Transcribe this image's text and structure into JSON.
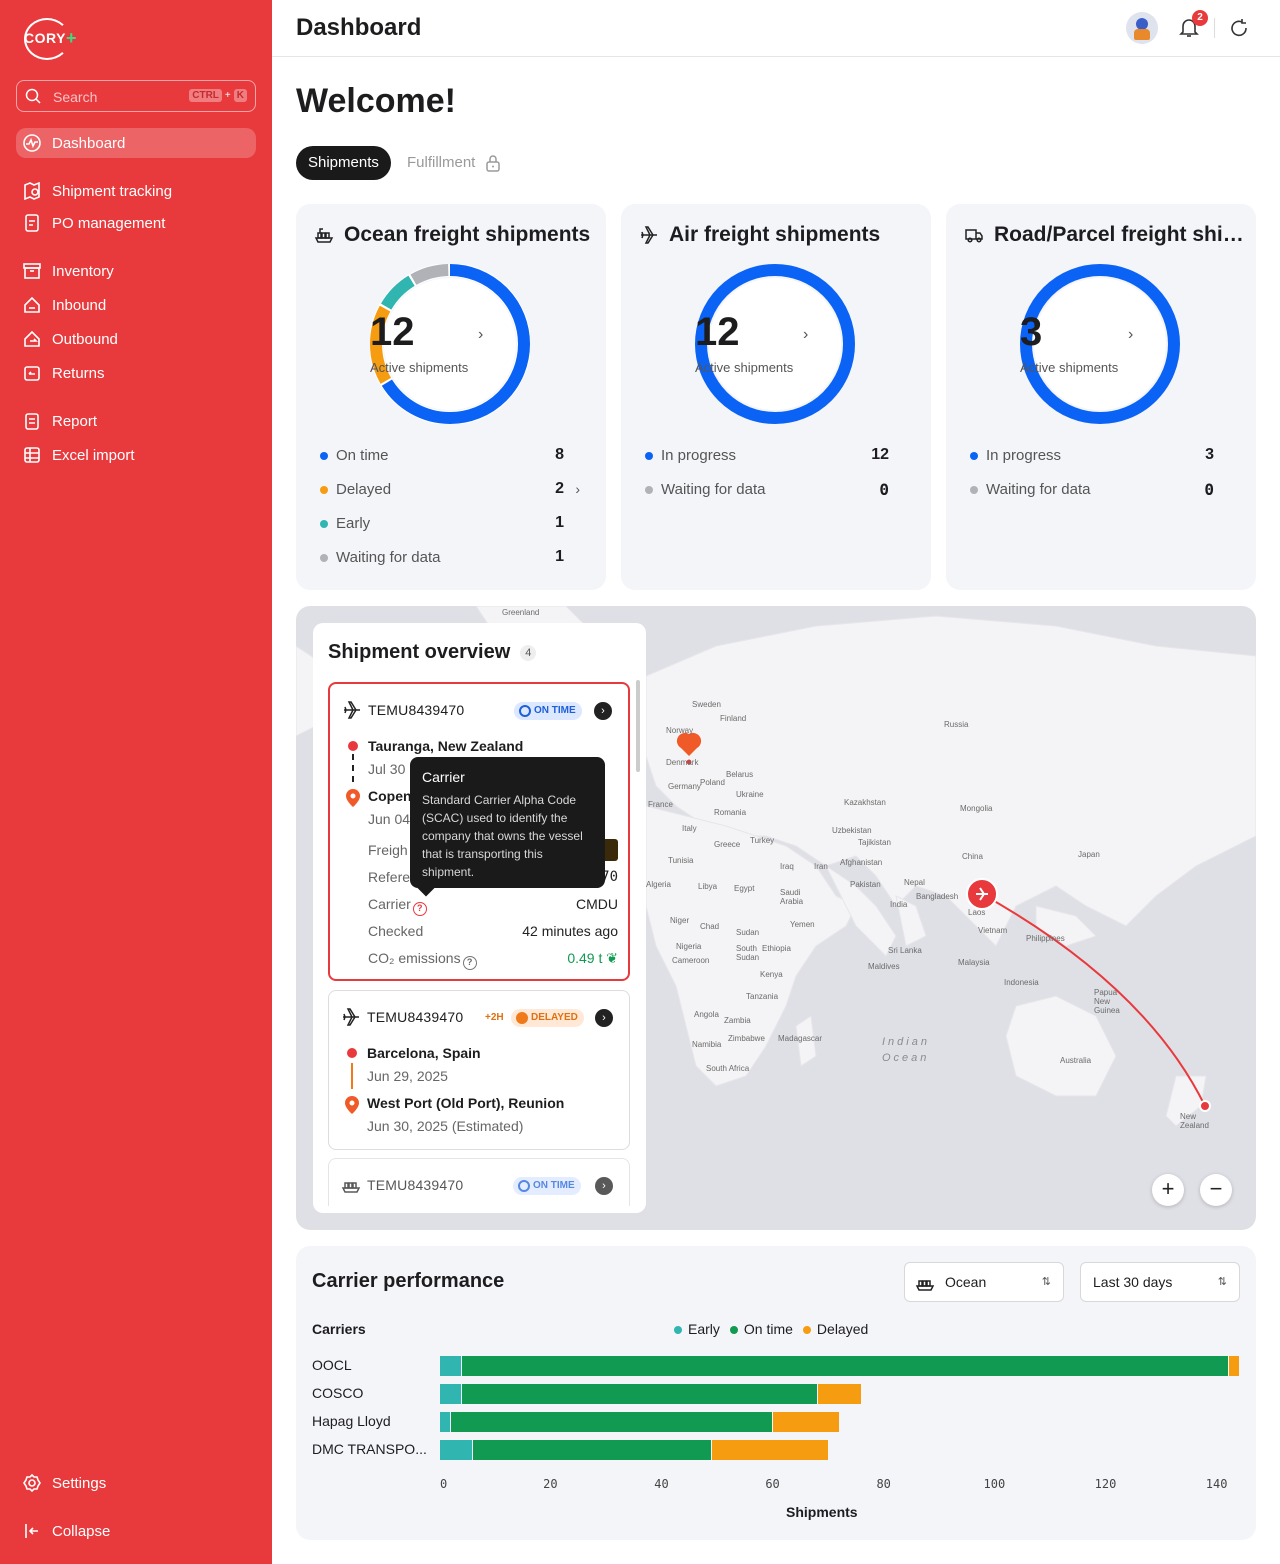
{
  "app": {
    "logo_text": "CORY",
    "title": "Dashboard"
  },
  "sidebar": {
    "search_placeholder": "Search",
    "shortcut": [
      "CTRL",
      "+",
      "K"
    ],
    "items": [
      {
        "label": "Dashboard",
        "icon": "dashboard-icon",
        "active": true
      },
      {
        "label": "Shipment tracking",
        "icon": "shipment-tracking-icon"
      },
      {
        "label": "PO management",
        "icon": "po-management-icon"
      },
      {
        "label": "Inventory",
        "icon": "inventory-icon"
      },
      {
        "label": "Inbound",
        "icon": "inbound-icon"
      },
      {
        "label": "Outbound",
        "icon": "outbound-icon"
      },
      {
        "label": "Returns",
        "icon": "returns-icon"
      },
      {
        "label": "Report",
        "icon": "report-icon"
      },
      {
        "label": "Excel import",
        "icon": "excel-import-icon"
      }
    ],
    "settings": "Settings",
    "collapse": "Collapse"
  },
  "header": {
    "notifications_count": "2"
  },
  "welcome": "Welcome!",
  "tabs": {
    "shipments": "Shipments",
    "fulfillment": "Fulfillment"
  },
  "cards": [
    {
      "title": "Ocean freight shipments",
      "count": "12",
      "count_label": "Active shipments",
      "legend": [
        {
          "label": "On time",
          "value": "8",
          "color": "#0b63f6"
        },
        {
          "label": "Delayed",
          "value": "2",
          "color": "#f59c11"
        },
        {
          "label": "Early",
          "value": "1",
          "color": "#30b5b0"
        },
        {
          "label": "Waiting for data",
          "value": "1",
          "color": "#b0b2b8"
        }
      ]
    },
    {
      "title": "Air freight shipments",
      "count": "12",
      "count_label": "Active shipments",
      "legend": [
        {
          "label": "In progress",
          "value": "12",
          "color": "#0b63f6"
        },
        {
          "label": "Waiting for data",
          "value": "0",
          "color": "#b0b2b8"
        }
      ]
    },
    {
      "title": "Road/Parcel freight shipments",
      "count": "3",
      "count_label": "Active shipments",
      "legend": [
        {
          "label": "In progress",
          "value": "3",
          "color": "#0b63f6"
        },
        {
          "label": "Waiting for data",
          "value": "0",
          "color": "#b0b2b8"
        }
      ]
    }
  ],
  "map": {
    "labels": [
      "Greenland",
      "Sweden",
      "Finland",
      "Norway",
      "Russia",
      "Denmark",
      "Poland",
      "Belarus",
      "Germany",
      "Ukraine",
      "France",
      "Kazakhstan",
      "Romania",
      "Mongolia",
      "Italy",
      "Uzbekistan",
      "Greece",
      "Turkey",
      "Tajikistan",
      "China",
      "Japan",
      "Tunisia",
      "Iraq",
      "Iran",
      "Afghanistan",
      "Algeria",
      "Libya",
      "Egypt",
      "Pakistan",
      "Nepal",
      "Saudi Arabia",
      "Bangladesh",
      "India",
      "Niger",
      "Sudan",
      "Chad",
      "Yemen",
      "Laos",
      "Vietnam",
      "Philippines",
      "Nigeria",
      "Ethiopia",
      "South Sudan",
      "Cameroon",
      "Sri Lanka",
      "Malaysia",
      "Kenya",
      "Maldives",
      "Indonesia",
      "Papua New Guinea",
      "Tanzania",
      "Angola",
      "Zambia",
      "Namibia",
      "Zimbabwe",
      "Madagascar",
      "South Africa",
      "Australia",
      "New Zealand"
    ],
    "ocean_label": [
      "Indian",
      "Ocean"
    ],
    "zoom_in": "+",
    "zoom_out": "−"
  },
  "overview": {
    "title": "Shipment overview",
    "count": "4",
    "shipments": [
      {
        "id": "TEMU8439470",
        "mode": "air",
        "status": "ON TIME",
        "origin": "Tauranga, New Zealand",
        "origin_date": "Jul 30",
        "destination": "Copen",
        "destination_date": "Jun 04",
        "rows": [
          {
            "label": "Freigh",
            "value": ""
          },
          {
            "label": "Refere",
            "value": "70"
          },
          {
            "label": "Carrier",
            "value": "CMDU"
          },
          {
            "label": "Checked",
            "value": "42 minutes ago"
          },
          {
            "label": "CO₂ emissions",
            "value": "0.49 t"
          }
        ]
      },
      {
        "id": "TEMU8439470",
        "mode": "air",
        "delay": "+2H",
        "status": "DELAYED",
        "origin": "Barcelona, Spain",
        "origin_date": "Jun 29, 2025",
        "destination": "West Port (Old Port), Reunion",
        "destination_date": "Jun 30, 2025 (Estimated)"
      },
      {
        "id": "TEMU8439470",
        "mode": "ocean",
        "status": "ON TIME"
      }
    ]
  },
  "tooltip": {
    "title": "Carrier",
    "body": "Standard Carrier Alpha Code (SCAC) used to identify the company that owns the vessel that is transporting this shipment."
  },
  "performance": {
    "title": "Carrier performance",
    "mode_select": "Ocean",
    "range_select": "Last 30 days",
    "carriers_label": "Carriers"
  },
  "chart_data": {
    "type": "bar",
    "orientation": "horizontal",
    "stacked": true,
    "categories": [
      "OOCL",
      "COSCO",
      "Hapag Lloyd",
      "DMC TRANSPO..."
    ],
    "series": [
      {
        "name": "Early",
        "color": "#30b5b0",
        "values": [
          4,
          4,
          2,
          6
        ]
      },
      {
        "name": "On time",
        "color": "#119a52",
        "values": [
          138,
          64,
          58,
          43
        ]
      },
      {
        "name": "Delayed",
        "color": "#f59c11",
        "values": [
          2,
          8,
          12,
          21
        ]
      }
    ],
    "xticks": [
      "0",
      "20",
      "40",
      "60",
      "80",
      "100",
      "120",
      "140"
    ],
    "xlim": [
      0,
      144
    ],
    "xlabel": "Shipments",
    "ylabel": "Carriers",
    "legend": "top"
  }
}
